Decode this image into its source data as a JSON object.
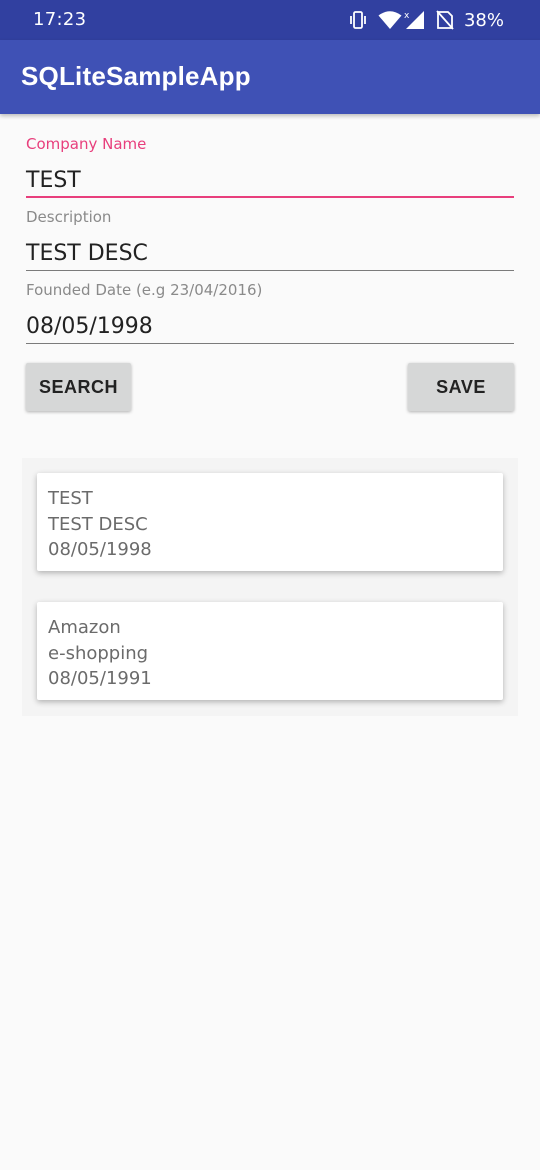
{
  "status_bar": {
    "time": "17:23",
    "battery": "38%",
    "icons": [
      "vibrate-icon",
      "wifi-icon",
      "signal-icon",
      "no-sim-icon"
    ]
  },
  "app_bar": {
    "title": "SQLiteSampleApp"
  },
  "form": {
    "company_name": {
      "label": "Company Name",
      "value": "TEST"
    },
    "description": {
      "label": "Description",
      "value": "TEST DESC"
    },
    "founded_date": {
      "label": "Founded Date (e.g 23/04/2016)",
      "value": "08/05/1998"
    }
  },
  "buttons": {
    "search": "SEARCH",
    "save": "SAVE"
  },
  "companies": [
    {
      "name": "TEST",
      "description": "TEST DESC",
      "date": "08/05/1998"
    },
    {
      "name": "Amazon",
      "description": "e-shopping",
      "date": "08/05/1991"
    }
  ],
  "colors": {
    "status_bar": "#3140a0",
    "app_bar": "#3f51b5",
    "accent": "#e83e7c",
    "background": "#fafafa"
  }
}
